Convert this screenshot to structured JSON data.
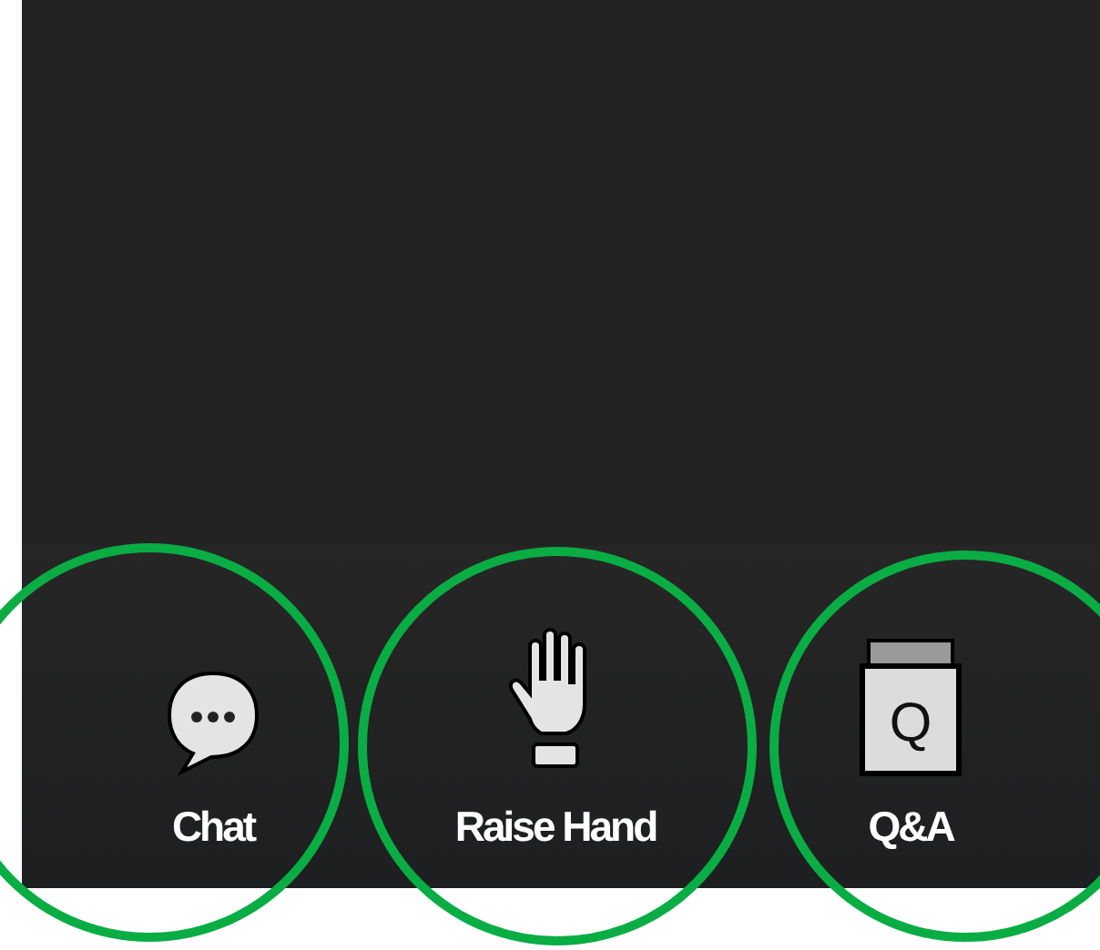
{
  "toolbar": {
    "buttons": [
      {
        "kind": "chat",
        "label": "Chat",
        "highlighted": true
      },
      {
        "kind": "raise-hand",
        "label": "Raise Hand",
        "highlighted": true
      },
      {
        "kind": "qa",
        "label": "Q&A",
        "icon_text": "Q",
        "highlighted": true
      }
    ]
  }
}
